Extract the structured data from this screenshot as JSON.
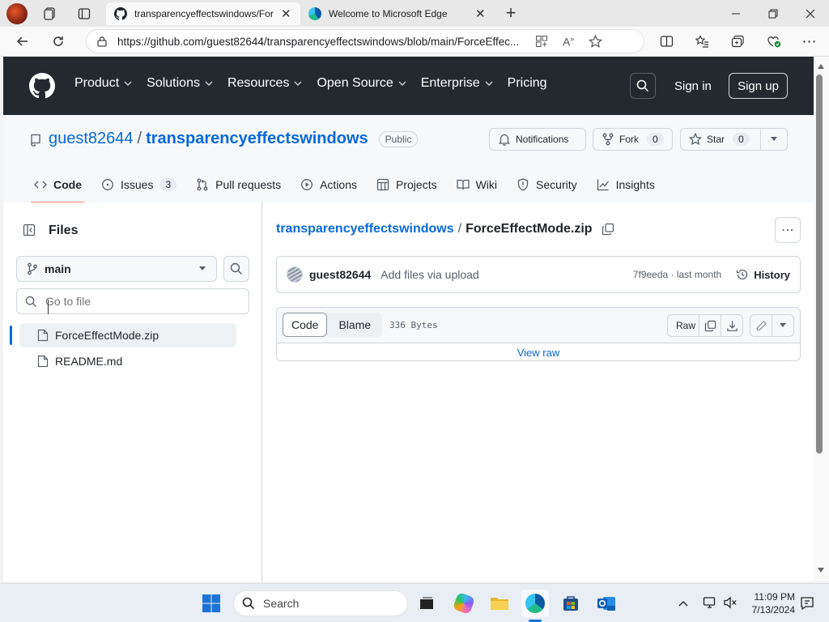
{
  "browser": {
    "tabs": [
      {
        "title": "transparencyeffectswindows/For",
        "active": true
      },
      {
        "title": "Welcome to Microsoft Edge",
        "active": false
      }
    ],
    "url": "https://github.com/guest82644/transparencyeffectswindows/blob/main/ForceEffec...",
    "new_tab_symbol": "+"
  },
  "header": {
    "nav": [
      "Product",
      "Solutions",
      "Resources",
      "Open Source",
      "Enterprise",
      "Pricing"
    ],
    "sign_in": "Sign in",
    "sign_up": "Sign up"
  },
  "repo": {
    "owner": "guest82644",
    "separator": "/",
    "name": "transparencyeffectswindows",
    "visibility": "Public",
    "notifications_label": "Notifications",
    "fork_label": "Fork",
    "fork_count": "0",
    "star_label": "Star",
    "star_count": "0",
    "tabs": [
      {
        "label": "Code",
        "icon": "code-icon"
      },
      {
        "label": "Issues",
        "icon": "issue-icon",
        "count": "3"
      },
      {
        "label": "Pull requests",
        "icon": "pull-request-icon"
      },
      {
        "label": "Actions",
        "icon": "play-icon"
      },
      {
        "label": "Projects",
        "icon": "table-icon"
      },
      {
        "label": "Wiki",
        "icon": "book-icon"
      },
      {
        "label": "Security",
        "icon": "shield-icon"
      },
      {
        "label": "Insights",
        "icon": "graph-icon"
      }
    ]
  },
  "sidebar": {
    "title": "Files",
    "branch": "main",
    "goto_placeholder": "Go to file",
    "files": [
      {
        "name": "ForceEffectMode.zip",
        "selected": true
      },
      {
        "name": "README.md",
        "selected": false
      }
    ]
  },
  "file": {
    "breadcrumb_repo": "transparencyeffectswindows",
    "breadcrumb_sep": "/",
    "name": "ForceEffectMode.zip",
    "commit_author": "guest82644",
    "commit_message": "Add files via upload",
    "commit_meta": "7f9eeda · last month",
    "history_label": "History",
    "view_code": "Code",
    "view_blame": "Blame",
    "size": "336 Bytes",
    "raw_label": "Raw",
    "view_raw_link": "View raw"
  },
  "taskbar": {
    "search_label": "Search",
    "time": "11:09 PM",
    "date": "7/13/2024"
  },
  "colors": {
    "github_header": "#24292f",
    "link": "#0969da",
    "accent_underline": "#fd8c73",
    "selected_file_bar": "#0969da"
  }
}
